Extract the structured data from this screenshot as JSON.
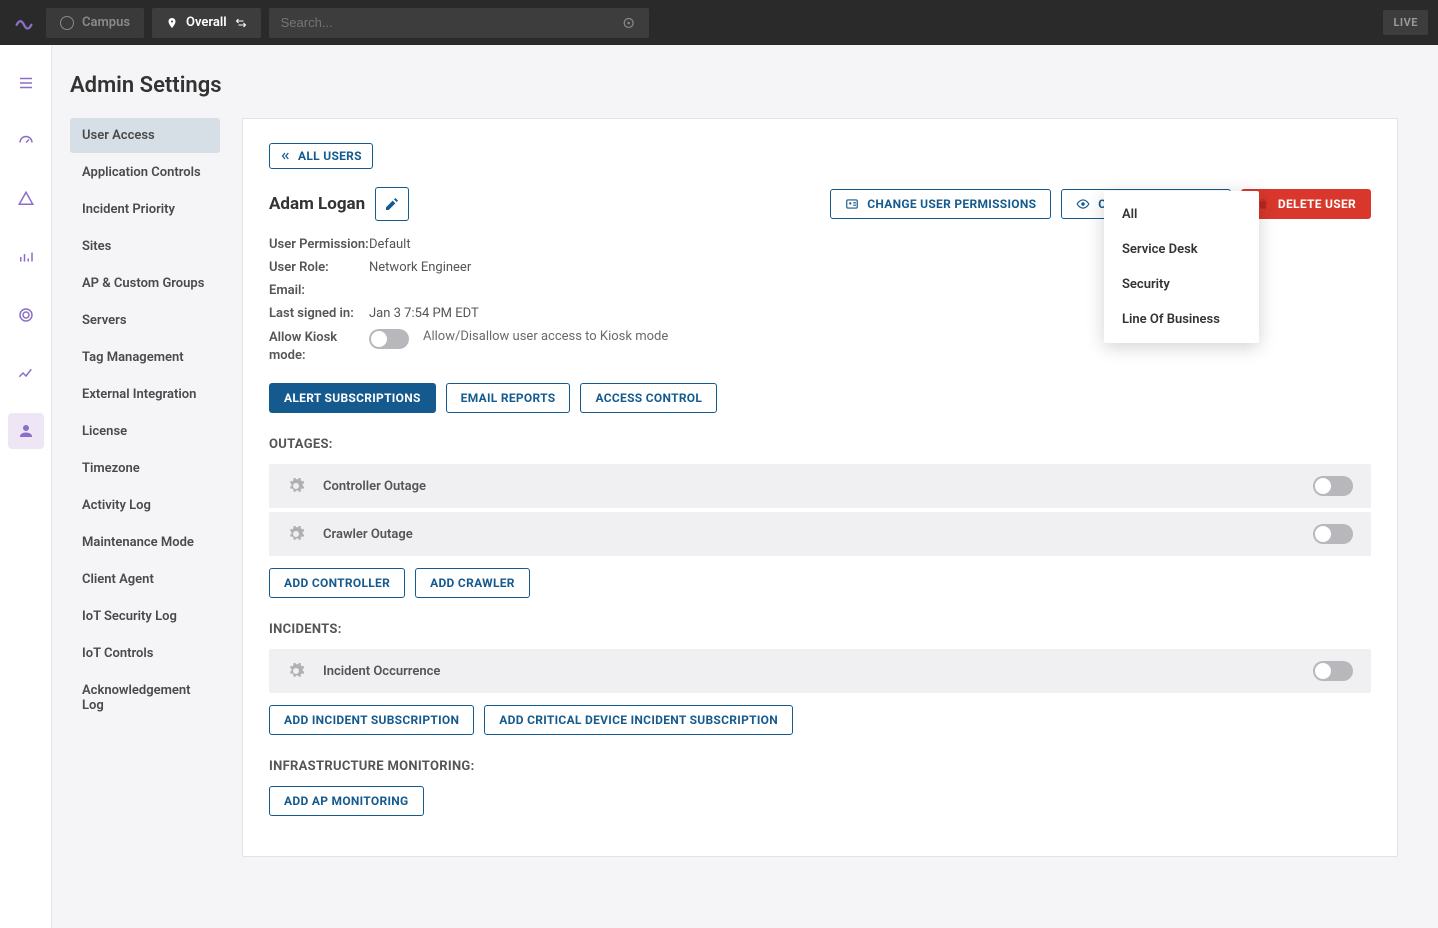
{
  "topbar": {
    "campus_label": "Campus",
    "overall_label": "Overall",
    "search_placeholder": "Search...",
    "live_label": "LIVE"
  },
  "page_title": "Admin Settings",
  "sidemenu": {
    "items": [
      "User Access",
      "Application Controls",
      "Incident Priority",
      "Sites",
      "AP & Custom Groups",
      "Servers",
      "Tag Management",
      "External Integration",
      "License",
      "Timezone",
      "Activity Log",
      "Maintenance Mode",
      "Client Agent",
      "IoT Security Log",
      "IoT Controls",
      "Acknowledgement Log"
    ],
    "active_index": 0
  },
  "panel": {
    "all_users_label": "ALL USERS",
    "user_name": "Adam Logan",
    "actions": {
      "change_permissions": "CHANGE USER PERMISSIONS",
      "change_role": "CHANGE USER ROLE",
      "delete_user": "DELETE USER"
    },
    "meta": {
      "permission_label": "User Permission:",
      "permission_value": "Default",
      "role_label": "User Role:",
      "role_value": "Network Engineer",
      "email_label": "Email:",
      "email_value": "",
      "signedin_label": "Last signed in:",
      "signedin_value": "Jan 3 7:54 PM EDT",
      "kiosk_label": "Allow Kiosk mode:",
      "kiosk_desc": "Allow/Disallow user access to Kiosk mode"
    },
    "tabs": {
      "alert": "ALERT SUBSCRIPTIONS",
      "email": "EMAIL REPORTS",
      "access": "ACCESS CONTROL"
    },
    "outages": {
      "heading": "OUTAGES:",
      "rows": [
        "Controller Outage",
        "Crawler Outage"
      ],
      "add_controller": "ADD CONTROLLER",
      "add_crawler": "ADD CRAWLER"
    },
    "incidents": {
      "heading": "INCIDENTS:",
      "rows": [
        "Incident Occurrence"
      ],
      "add_incident": "ADD INCIDENT SUBSCRIPTION",
      "add_critical": "ADD CRITICAL DEVICE INCIDENT SUBSCRIPTION"
    },
    "infra": {
      "heading": "INFRASTRUCTURE MONITORING:",
      "add_ap": "ADD AP MONITORING"
    },
    "role_dropdown": [
      "All",
      "Service Desk",
      "Security",
      "Line Of Business"
    ]
  }
}
